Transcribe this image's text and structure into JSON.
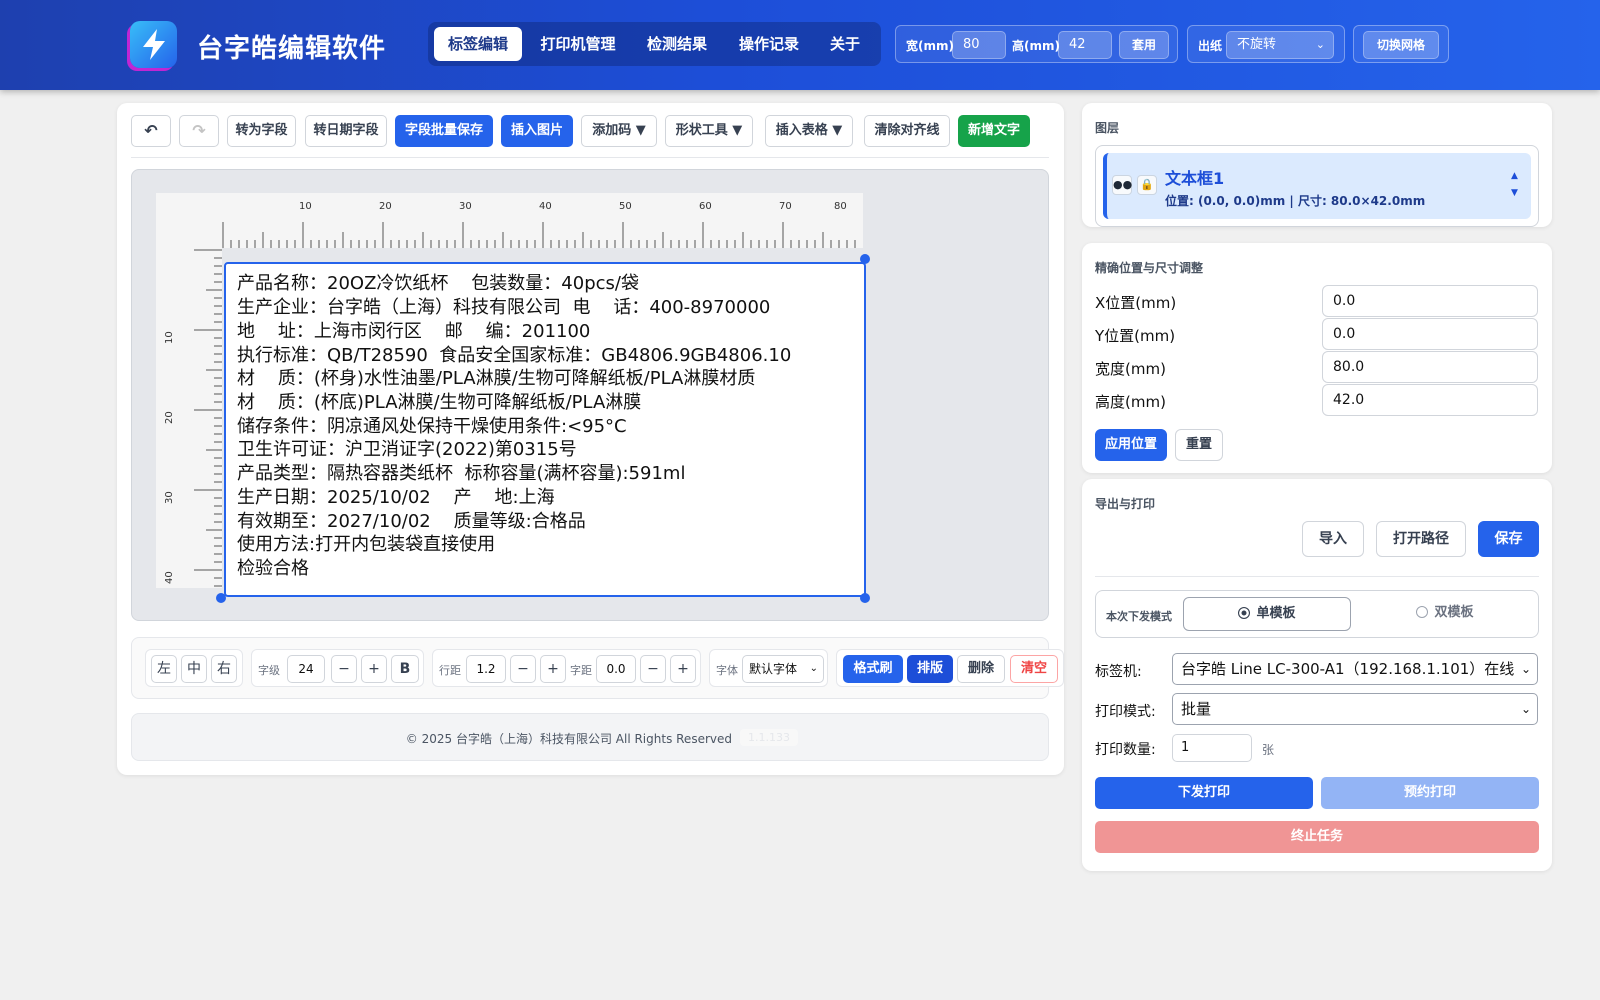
{
  "header": {
    "app_title": "台字皓编辑软件",
    "tabs": [
      {
        "label": "标签编辑"
      },
      {
        "label": "打印机管理"
      },
      {
        "label": "检测结果"
      },
      {
        "label": "操作记录"
      },
      {
        "label": "关于"
      }
    ],
    "width_label": "宽(mm)",
    "width_value": "80",
    "height_label": "高(mm)",
    "height_value": "42",
    "apply_label": "套用",
    "paper_label": "出纸",
    "paper_value": "不旋转",
    "grid_label": "切换网格"
  },
  "toolbar": {
    "to_field": "转为字段",
    "to_date_field": "转日期字段",
    "batch_save": "字段批量保存",
    "insert_image": "插入图片",
    "add_code": "添加码 ▼",
    "shape_tool": "形状工具 ▼",
    "insert_table": "插入表格 ▼",
    "clear_guides": "清除对齐线",
    "add_text": "新增文字"
  },
  "ruler": {
    "top": [
      "10",
      "20",
      "30",
      "40",
      "50",
      "60",
      "70",
      "80"
    ],
    "left": [
      "10",
      "20",
      "30",
      "40"
    ]
  },
  "label_lines": [
    "产品名称：20OZ冷饮纸杯    包装数量：40pcs/袋",
    "生产企业：台字皓（上海）科技有限公司  电    话：400-8970000",
    "地    址：上海市闵行区    邮    编：201100",
    "执行标准：QB/T28590  食品安全国家标准：GB4806.9GB4806.10",
    "材    质：(杯身)水性油墨/PLA淋膜/生物可降解纸板/PLA淋膜材质",
    "材    质：(杯底)PLA淋膜/生物可降解纸板/PLA淋膜",
    "储存条件：阴凉通风处保持干燥使用条件:<95°C",
    "卫生许可证：沪卫消证字(2022)第0315号",
    "产品类型：隔热容器类纸杯  标称容量(满杯容量):591ml",
    "生产日期：2025/10/02    产    地:上海",
    "有效期至：2027/10/02    质量等级:合格品",
    "使用方法:打开内包装袋直接使用",
    "检验合格"
  ],
  "format": {
    "align_left": "左",
    "align_center": "中",
    "align_right": "右",
    "size_label": "字级",
    "size_value": "24",
    "minus": "−",
    "plus": "+",
    "bold": "B",
    "line_label": "行距",
    "line_value": "1.2",
    "spacing_label": "字距",
    "spacing_value": "0.0",
    "font_label": "字体",
    "font_value": "默认字体",
    "format_brush": "格式刷",
    "layout": "排版",
    "delete": "删除",
    "clear": "清空"
  },
  "footer": {
    "copyright": "© 2025 台字皓（上海）科技有限公司 All Rights Reserved",
    "version": "1.1.133"
  },
  "layers": {
    "title": "图层",
    "item_name": "文本框1",
    "item_meta": "位置: (0.0, 0.0)mm | 尺寸: 80.0×42.0mm"
  },
  "position": {
    "title": "精确位置与尺寸调整",
    "x_label": "X位置(mm)",
    "x_value": "0.0",
    "y_label": "Y位置(mm)",
    "y_value": "0.0",
    "w_label": "宽度(mm)",
    "w_value": "80.0",
    "h_label": "高度(mm)",
    "h_value": "42.0",
    "apply": "应用位置",
    "reset": "重置"
  },
  "export": {
    "title": "导出与打印",
    "import": "导入",
    "open_path": "打开路径",
    "save": "保存",
    "mode_label": "本次下发模式",
    "single": "单模板",
    "double": "双模板",
    "printer_label": "标签机:",
    "printer_value": "台字皓 Line LC-300-A1（192.168.1.101）在线",
    "print_mode_label": "打印模式:",
    "print_mode_value": "批量",
    "qty_label": "打印数量:",
    "qty_value": "1",
    "qty_unit": "张",
    "send_print": "下发打印",
    "schedule_print": "预约打印",
    "stop_task": "终止任务"
  },
  "colors": {
    "primary": "#2563eb",
    "success": "#16a34a",
    "danger": "#ef4444",
    "disabled": "#93b4f5"
  }
}
